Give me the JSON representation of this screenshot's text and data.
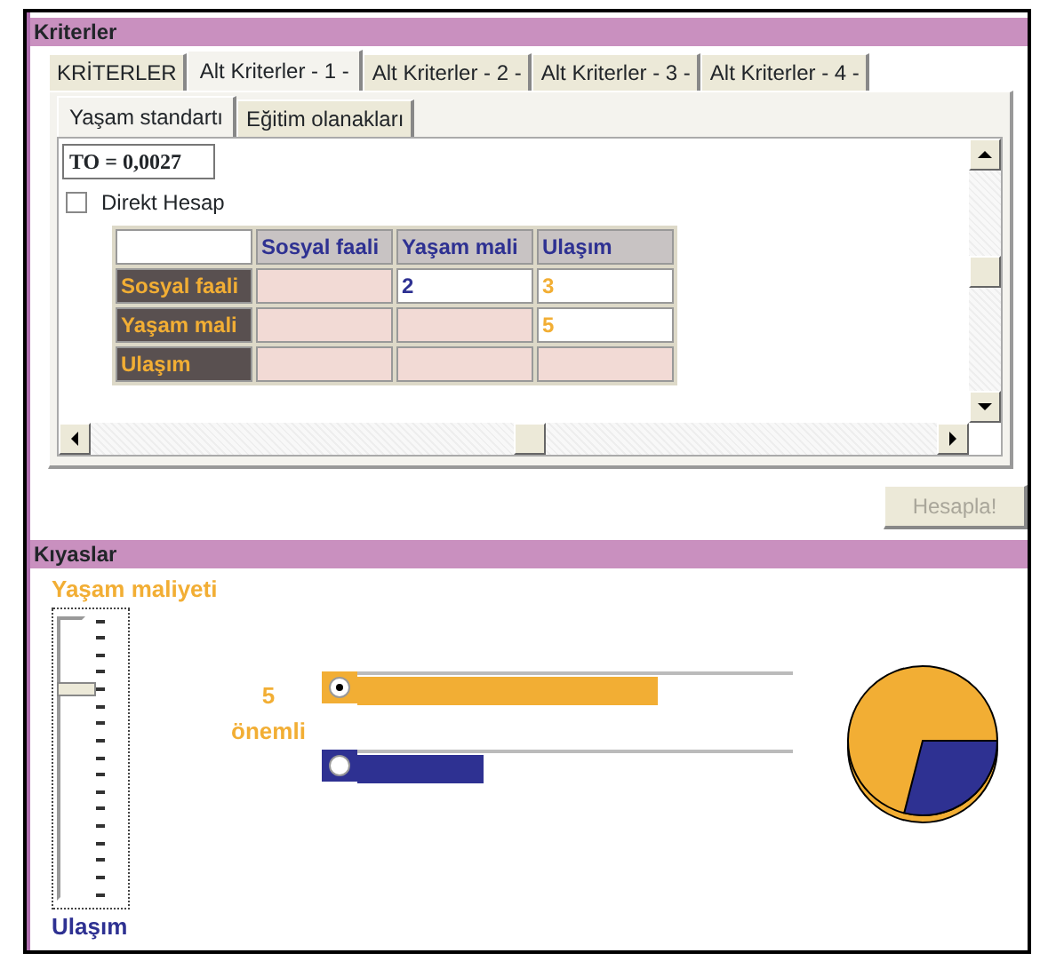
{
  "criteria_panel": {
    "title": "Kriterler"
  },
  "tabs": [
    {
      "label": "KRİTERLER",
      "selected": false
    },
    {
      "label": "Alt Kriterler - 1 -",
      "selected": true
    },
    {
      "label": "Alt Kriterler - 2 -",
      "selected": false
    },
    {
      "label": "Alt Kriterler - 3 -",
      "selected": false
    },
    {
      "label": "Alt Kriterler - 4 -",
      "selected": false
    }
  ],
  "subtabs": [
    {
      "label": "Yaşam standartı",
      "selected": true
    },
    {
      "label": "Eğitim olanakları",
      "selected": false
    }
  ],
  "consistency": {
    "value": "TO = 0,0027"
  },
  "direct_calc": {
    "label": "Direkt Hesap",
    "checked": false
  },
  "matrix": {
    "columns": [
      "Sosyal faali",
      "Yaşam mali",
      "Ulaşım"
    ],
    "rows": [
      {
        "label": "Sosyal faali",
        "cells": [
          {
            "kind": "locked"
          },
          {
            "kind": "value",
            "text": "2",
            "color": "#2e3192"
          },
          {
            "kind": "value",
            "text": "3",
            "color": "#f2ae34"
          }
        ]
      },
      {
        "label": "Yaşam mali",
        "cells": [
          {
            "kind": "locked"
          },
          {
            "kind": "locked"
          },
          {
            "kind": "value",
            "text": "5",
            "color": "#f2ae34"
          }
        ]
      },
      {
        "label": "Ulaşım",
        "cells": [
          {
            "kind": "locked"
          },
          {
            "kind": "locked"
          },
          {
            "kind": "locked"
          }
        ]
      }
    ]
  },
  "calc_button": {
    "label": "Hesapla!",
    "disabled": true
  },
  "comparison_panel": {
    "title": "Kıyaslar"
  },
  "slider": {
    "top_label": "Yaşam maliyeti",
    "bottom_label": "Ulaşım",
    "level": 0.75
  },
  "importance": {
    "value": "5",
    "label": "önemli"
  },
  "bars": [
    {
      "color": "#f2ae34",
      "level": 0.69,
      "selected": true
    },
    {
      "color": "#2e3192",
      "level": 0.29,
      "selected": false
    }
  ]
}
